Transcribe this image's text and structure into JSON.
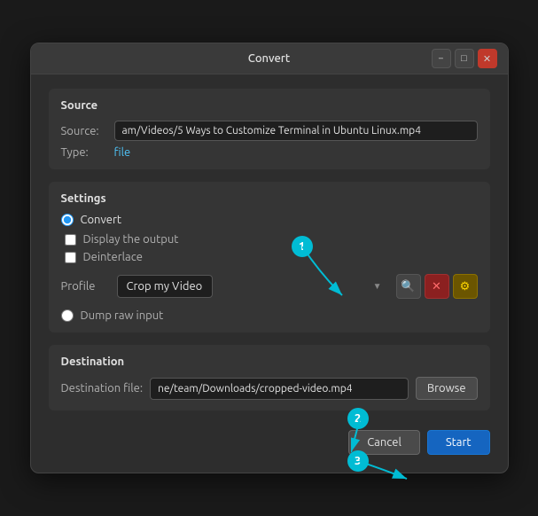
{
  "window": {
    "title": "Convert",
    "controls": {
      "minimize": "−",
      "maximize": "□",
      "close": "✕"
    }
  },
  "source": {
    "label": "Source",
    "source_label": "Source:",
    "source_value": "am/Videos/5 Ways to Customize Terminal in Ubuntu Linux.mp4",
    "type_label": "Type:",
    "type_value": "file"
  },
  "settings": {
    "label": "Settings",
    "convert_label": "Convert",
    "display_output_label": "Display the output",
    "deinterlace_label": "Deinterlace",
    "profile_label": "Profile",
    "profile_value": "Crop my Video",
    "dump_raw_label": "Dump raw input",
    "annotation1": "1"
  },
  "destination": {
    "label": "Destination",
    "dest_label": "Destination file:",
    "dest_value": "ne/team/Downloads/cropped-video.mp4",
    "browse_label": "Browse",
    "annotation2": "2"
  },
  "buttons": {
    "cancel": "Cancel",
    "start": "Start",
    "annotation3": "3"
  },
  "icons": {
    "search": "🔍",
    "delete": "✕",
    "settings": "⚙"
  }
}
